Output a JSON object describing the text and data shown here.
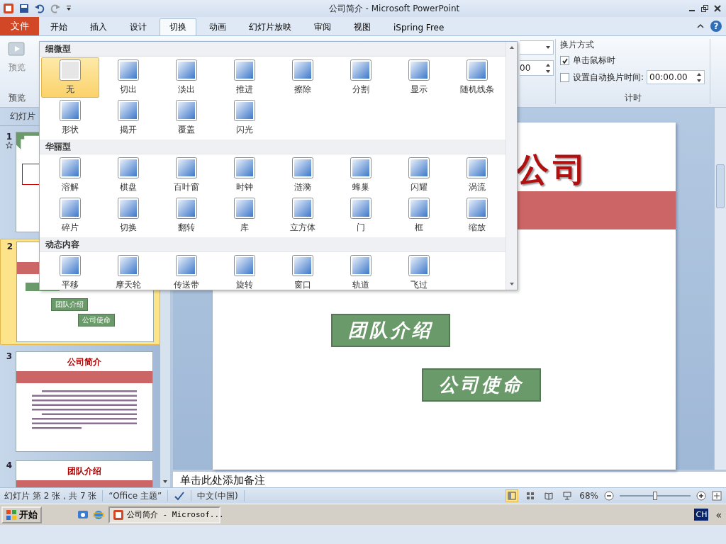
{
  "window": {
    "title": "公司简介 - Microsoft PowerPoint"
  },
  "ribbon_tabs": [
    {
      "label": "文件",
      "kind": "file",
      "selected": false
    },
    {
      "label": "开始",
      "kind": "tab",
      "selected": false
    },
    {
      "label": "插入",
      "kind": "tab",
      "selected": false
    },
    {
      "label": "设计",
      "kind": "tab",
      "selected": false
    },
    {
      "label": "切换",
      "kind": "tab",
      "selected": true
    },
    {
      "label": "动画",
      "kind": "tab",
      "selected": false
    },
    {
      "label": "幻灯片放映",
      "kind": "tab",
      "selected": false
    },
    {
      "label": "审阅",
      "kind": "tab",
      "selected": false
    },
    {
      "label": "视图",
      "kind": "tab",
      "selected": false
    },
    {
      "label": "iSpring Free",
      "kind": "tab",
      "selected": false
    }
  ],
  "help": "?",
  "ribbon": {
    "preview_button": "预览",
    "preview_group": "预览",
    "partial_spinner_value": "00",
    "advance_group": {
      "title": "换片方式",
      "on_click": {
        "label": "单击鼠标时",
        "checked": true
      },
      "after_time": {
        "label": "设置自动换片时间:",
        "checked": false,
        "value": "00:00.00"
      }
    },
    "timing_group": "计时"
  },
  "gallery": {
    "sections": [
      {
        "title": "细微型",
        "items": [
          {
            "label": "无",
            "selected": true
          },
          {
            "label": "切出",
            "selected": false
          },
          {
            "label": "淡出",
            "selected": false
          },
          {
            "label": "推进",
            "selected": false
          },
          {
            "label": "擦除",
            "selected": false
          },
          {
            "label": "分割",
            "selected": false
          },
          {
            "label": "显示",
            "selected": false
          },
          {
            "label": "随机线条",
            "selected": false
          },
          {
            "label": "形状",
            "selected": false
          },
          {
            "label": "揭开",
            "selected": false
          },
          {
            "label": "覆盖",
            "selected": false
          },
          {
            "label": "闪光",
            "selected": false
          }
        ]
      },
      {
        "title": "华丽型",
        "items": [
          {
            "label": "溶解",
            "selected": false
          },
          {
            "label": "棋盘",
            "selected": false
          },
          {
            "label": "百叶窗",
            "selected": false
          },
          {
            "label": "时钟",
            "selected": false
          },
          {
            "label": "涟漪",
            "selected": false
          },
          {
            "label": "蜂巢",
            "selected": false
          },
          {
            "label": "闪耀",
            "selected": false
          },
          {
            "label": "涡流",
            "selected": false
          },
          {
            "label": "碎片",
            "selected": false
          },
          {
            "label": "切换",
            "selected": false
          },
          {
            "label": "翻转",
            "selected": false
          },
          {
            "label": "库",
            "selected": false
          },
          {
            "label": "立方体",
            "selected": false
          },
          {
            "label": "门",
            "selected": false
          },
          {
            "label": "框",
            "selected": false
          },
          {
            "label": "缩放",
            "selected": false
          }
        ]
      },
      {
        "title": "动态内容",
        "items": [
          {
            "label": "平移",
            "selected": false
          },
          {
            "label": "摩天轮",
            "selected": false
          },
          {
            "label": "传送带",
            "selected": false
          },
          {
            "label": "旋转",
            "selected": false
          },
          {
            "label": "窗口",
            "selected": false
          },
          {
            "label": "轨道",
            "selected": false
          },
          {
            "label": "飞过",
            "selected": false
          }
        ]
      }
    ]
  },
  "slides_panel": {
    "tab": "幻灯片",
    "slides": [
      {
        "number": "1",
        "kind": "cover",
        "selected": false,
        "animated": true
      },
      {
        "number": "2",
        "kind": "menu",
        "selected": true,
        "animated": false,
        "buttons": [
          "团队介绍",
          "公司使命"
        ]
      },
      {
        "number": "3",
        "kind": "text",
        "selected": false,
        "animated": false,
        "title": "公司简介"
      },
      {
        "number": "4",
        "kind": "heading",
        "selected": false,
        "animated": false,
        "title": "团队介绍"
      }
    ]
  },
  "current_slide": {
    "title": "公司",
    "buttons": [
      "团队介绍",
      "公司使命"
    ]
  },
  "notes": {
    "placeholder": "单击此处添加备注"
  },
  "status_bar": {
    "slide_info": "幻灯片 第 2 张，共 7 张",
    "theme": "“Office 主题”",
    "language": "中文(中国)",
    "views": [
      {
        "kind": "normal",
        "selected": true
      },
      {
        "kind": "sorter",
        "selected": false
      },
      {
        "kind": "reading",
        "selected": false
      },
      {
        "kind": "show",
        "selected": false
      }
    ],
    "zoom": "68%",
    "zoom_slider": {
      "level": 0.5
    }
  },
  "taskbar": {
    "start": "开始",
    "task": "公司简介 - Microsof...",
    "language": "CH",
    "expand": "«"
  }
}
